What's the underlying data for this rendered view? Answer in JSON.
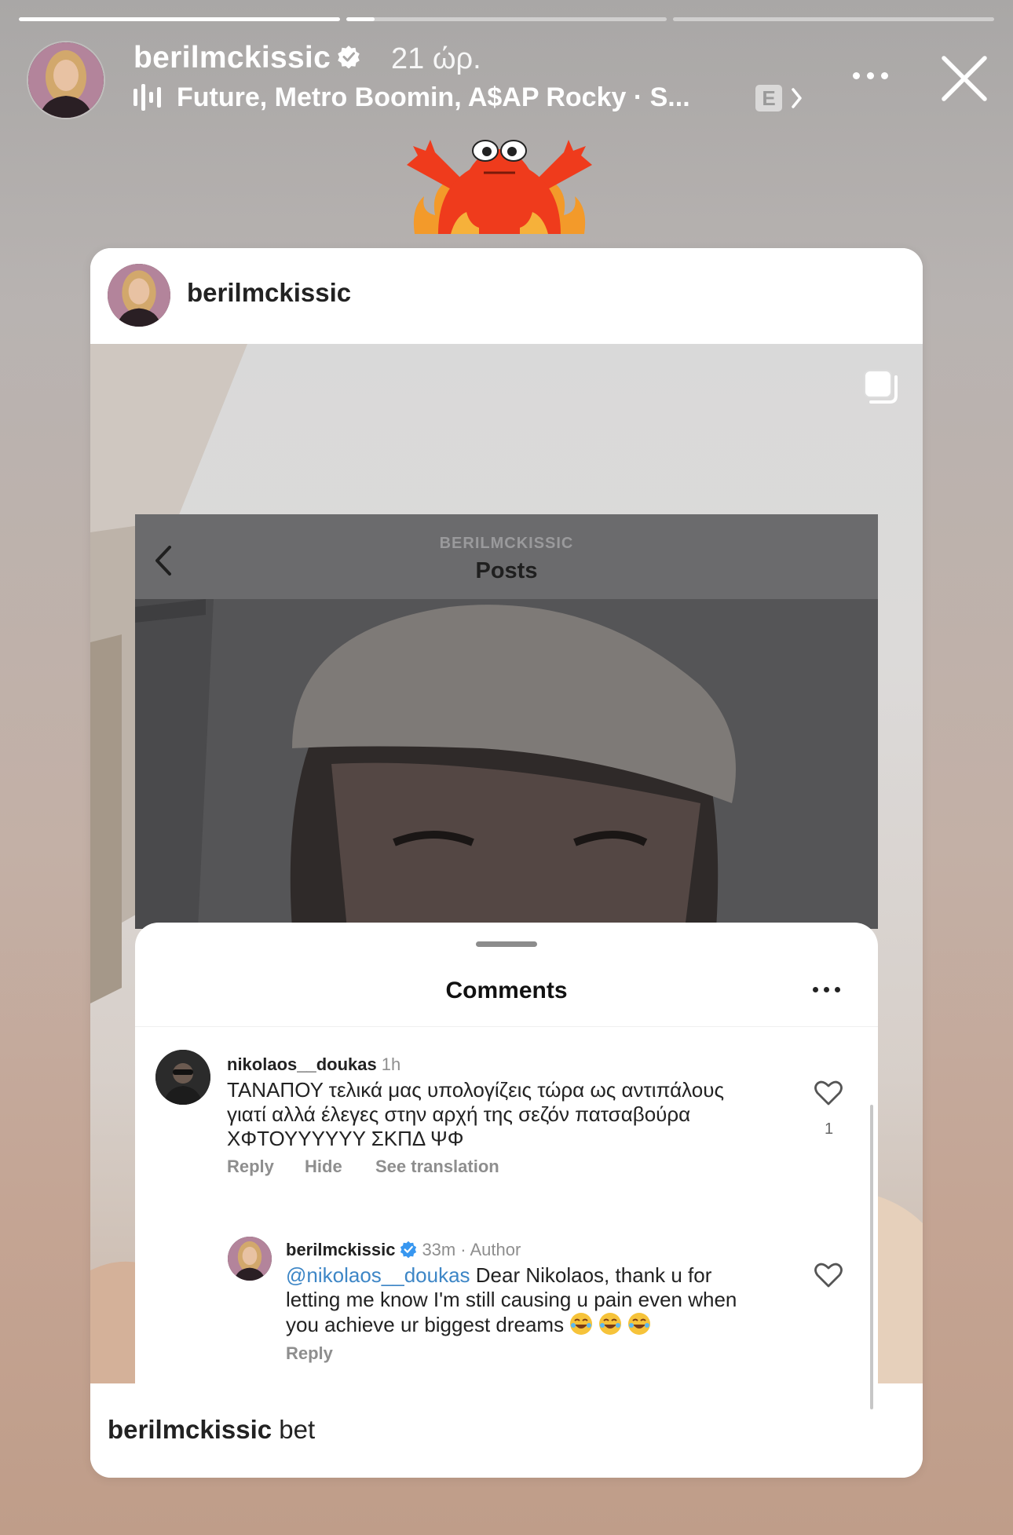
{
  "story": {
    "progress": [
      1.0,
      0.09,
      0.0,
      0.0
    ],
    "username": "berilmckissic",
    "time": "21 ώρ.",
    "music": "Future, Metro Boomin, A$AP Rocky · S...",
    "explicit_badge": "E",
    "icons": [
      "verified-icon",
      "music-bars-icon",
      "chevron-right-icon",
      "more-icon",
      "close-icon"
    ]
  },
  "post": {
    "username": "berilmckissic",
    "caption_user": "berilmckissic",
    "caption_text": " bet",
    "icons": [
      "carousel-icon"
    ]
  },
  "inner": {
    "subtitle": "BERILMCKISSIC",
    "title": "Posts",
    "icons": [
      "back-chevron-icon"
    ]
  },
  "comments_sheet": {
    "title": "Comments",
    "comments": [
      {
        "user": "nikolaos__doukas",
        "time": "1h",
        "text_lines": [
          "ΤΑΝΑΠΟΥ τελικά μας υπολογίζεις τώρα ως αντιπάλους",
          "γιατί αλλά έλεγες στην αρχή της σεζόν πατσαβούρα",
          "ΧΦΤΟΥΥΥΥΥΥ ΣΚΠΔ ΨΦ"
        ],
        "actions": [
          "Reply",
          "Hide",
          "See translation"
        ],
        "likes": "1"
      },
      {
        "user": "berilmckissic",
        "time": "33m",
        "role": "· Author",
        "mention": "@nikolaos__doukas",
        "text_line1": " Dear Nikolaos, thank u for",
        "text_line2": "letting me know I'm still causing u pain even when",
        "text_line3": "you achieve ur biggest dreams",
        "actions": [
          "Reply"
        ]
      }
    ]
  },
  "colors": {
    "mention": "#3d86c6",
    "verified": "#3897f0",
    "sticker": "#ef3b1c"
  }
}
